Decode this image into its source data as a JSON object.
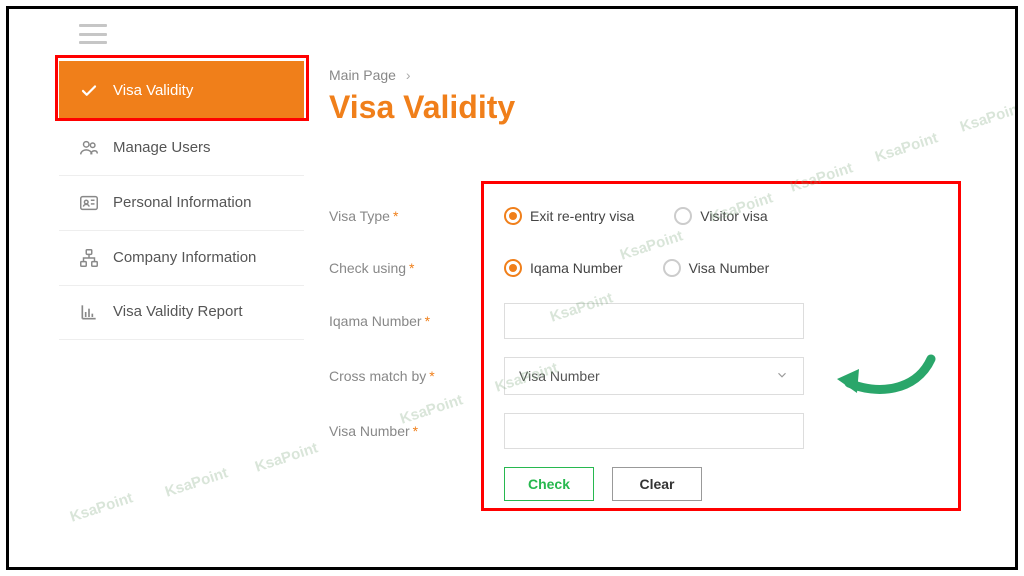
{
  "breadcrumb": {
    "root": "Main Page"
  },
  "page_title": "Visa Validity",
  "sidebar": {
    "items": [
      {
        "label": "Visa Validity"
      },
      {
        "label": "Manage Users"
      },
      {
        "label": "Personal Information"
      },
      {
        "label": "Company Information"
      },
      {
        "label": "Visa Validity Report"
      }
    ]
  },
  "form": {
    "visa_type_label": "Visa Type",
    "check_using_label": "Check using",
    "iqama_number_label": "Iqama Number",
    "cross_match_label": "Cross match by",
    "visa_number_label": "Visa Number",
    "visa_type_options": {
      "exit_reentry": "Exit re-entry visa",
      "visitor": "Visitor visa"
    },
    "check_using_options": {
      "iqama": "Iqama Number",
      "visa": "Visa Number"
    },
    "cross_match_selected": "Visa Number",
    "iqama_number_value": "",
    "visa_number_value": ""
  },
  "buttons": {
    "check": "Check",
    "clear": "Clear"
  },
  "watermark_text": "KsaPoint"
}
